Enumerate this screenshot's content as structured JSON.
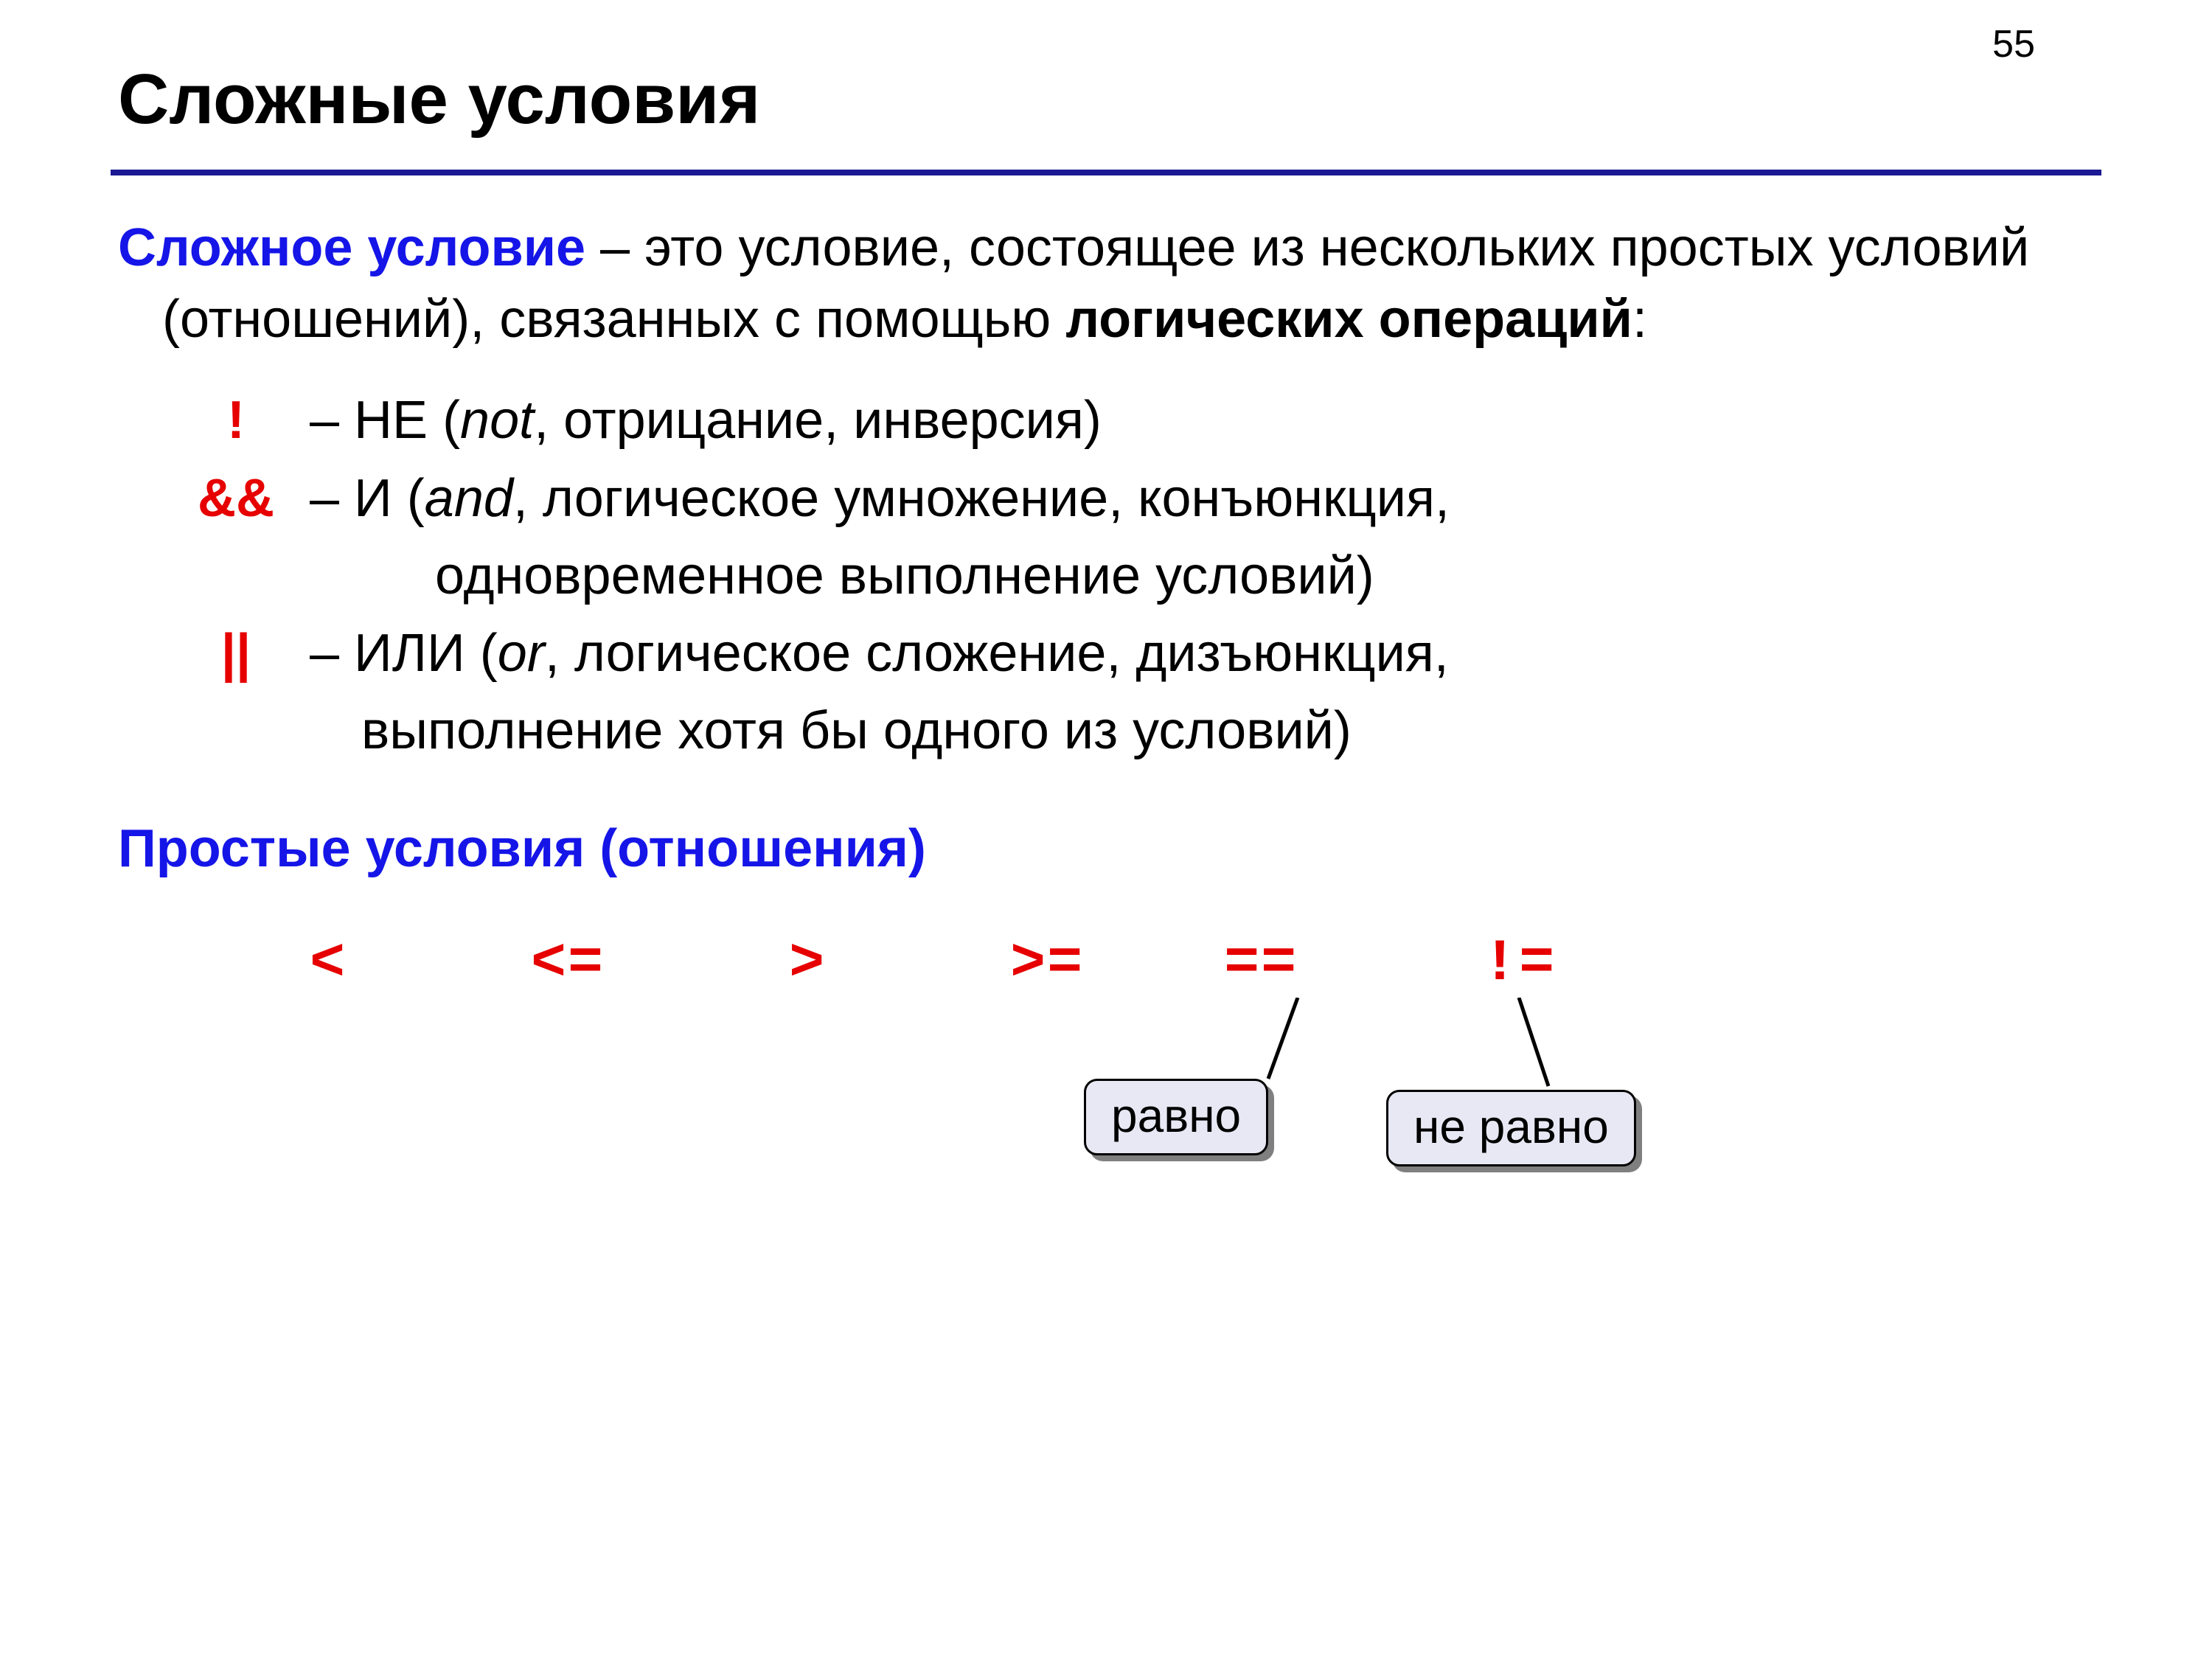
{
  "page_number": "55",
  "title": "Сложные условия",
  "definition": {
    "term": "Сложное условие",
    "dash": " – это условие, состоящее из нескольких простых условий (отношений), связанных с помощью ",
    "bold_tail": "логических операций",
    "colon": ":"
  },
  "ops": {
    "not": {
      "sym": "!",
      "prefix": "– НЕ (",
      "en": "not",
      "rest": ", отрицание, инверсия)"
    },
    "and": {
      "sym": "&&",
      "prefix": "– И (",
      "en": "and",
      "rest": ", логическое умножение, конъюнкция,",
      "cont": "одновременное выполнение условий)"
    },
    "or": {
      "sym": "||",
      "prefix": "– ИЛИ (",
      "en": "or",
      "rest": ", логическое сложение, дизъюнкция,",
      "cont": "выполнение хотя бы одного из условий)"
    }
  },
  "simple_head": "Простые условия (отношения)",
  "rel": {
    "lt": "<",
    "le": "<=",
    "gt": ">",
    "ge": ">=",
    "eq": "==",
    "ne": "!="
  },
  "callout": {
    "eq": "равно",
    "ne": "не равно"
  }
}
